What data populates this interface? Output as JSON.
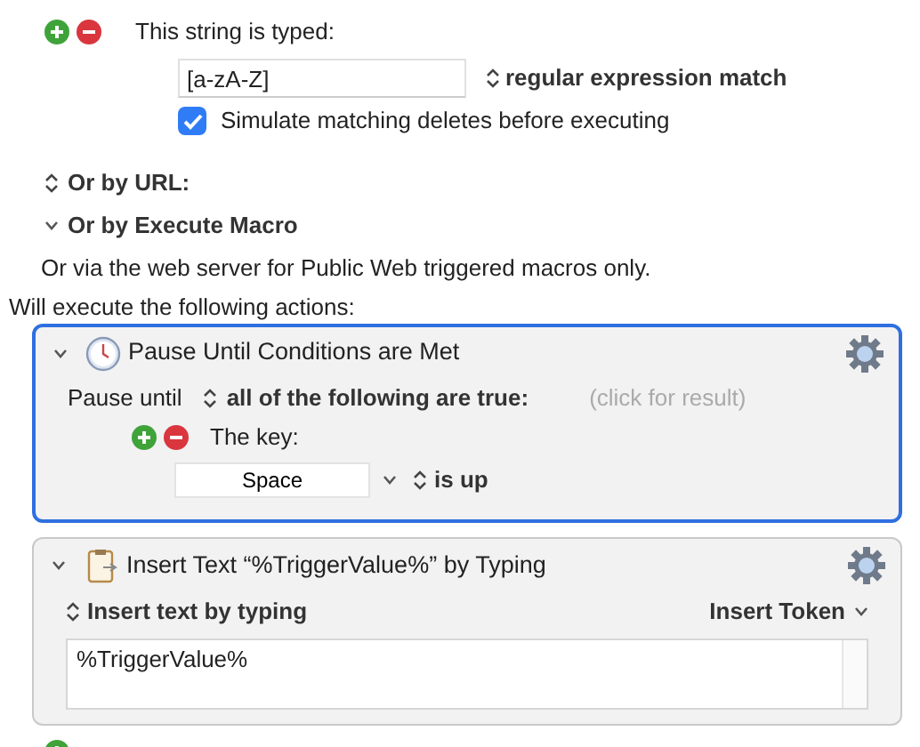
{
  "trigger": {
    "label": "This string is typed:",
    "value": "[a-zA-Z]",
    "match_mode": "regular expression match",
    "simulate_deletes": {
      "label": "Simulate matching deletes before executing",
      "checked": true
    }
  },
  "sections": [
    {
      "kind": "popup",
      "label": "Or by URL:"
    },
    {
      "kind": "disclosure",
      "label": "Or by Execute Macro",
      "expanded": true
    }
  ],
  "note": "Or via the web server for Public Web triggered macros only.",
  "actions_heading": "Will execute the following actions:",
  "actions": [
    {
      "kind": "pause",
      "title": "Pause Until Conditions are Met",
      "selected": true,
      "expanded": true,
      "prefix": "Pause until",
      "mode": "all of the following are true:",
      "result_hint": "(click for result)",
      "conditions": [
        {
          "label": "The key:",
          "key": "Space",
          "state": "is up"
        }
      ]
    },
    {
      "kind": "insert_text",
      "title": "Insert Text “%TriggerValue%” by Typing",
      "selected": false,
      "expanded": true,
      "mode": "Insert text by typing",
      "token_menu": "Insert Token",
      "text": "%TriggerValue%"
    }
  ]
}
